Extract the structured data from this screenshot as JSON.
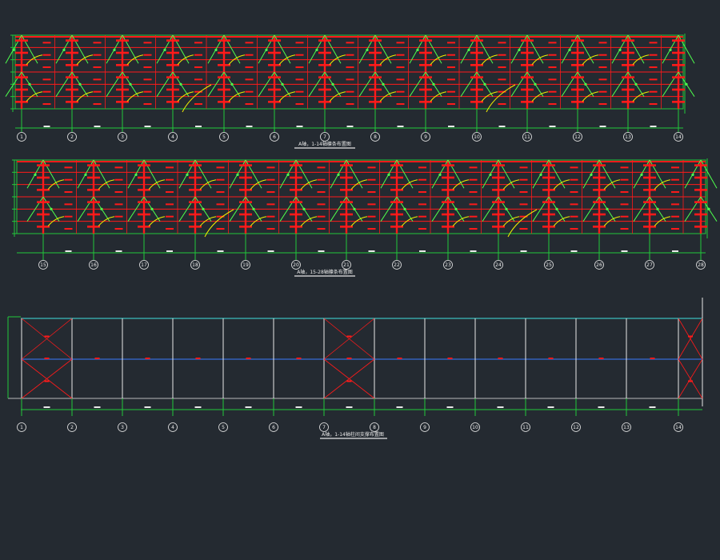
{
  "colors": {
    "background": "#242a31",
    "grid": "#22c83a",
    "member": "#ff1a1a",
    "diag": "#4dff4d",
    "curve": "#f0f000",
    "white": "#e8e8e8",
    "cyan": "#40e0e0",
    "blue": "#3a7bff"
  },
  "drawing1": {
    "title": "A轴，1-14轴檩条布置图",
    "axis_labels": [
      "1",
      "2",
      "3",
      "4",
      "5",
      "6",
      "7",
      "8",
      "9",
      "10",
      "11",
      "12",
      "13",
      "14"
    ]
  },
  "drawing2": {
    "title": "A轴，15-28轴檩条布置图",
    "axis_labels": [
      "15",
      "16",
      "17",
      "18",
      "19",
      "20",
      "21",
      "22",
      "23",
      "24",
      "25",
      "26",
      "27",
      "28"
    ]
  },
  "drawing3": {
    "title": "A轴，1-14轴柱间支撑布置图",
    "axis_labels": [
      "1",
      "2",
      "3",
      "4",
      "5",
      "6",
      "7",
      "8",
      "9",
      "10",
      "11",
      "12",
      "13",
      "14"
    ]
  }
}
